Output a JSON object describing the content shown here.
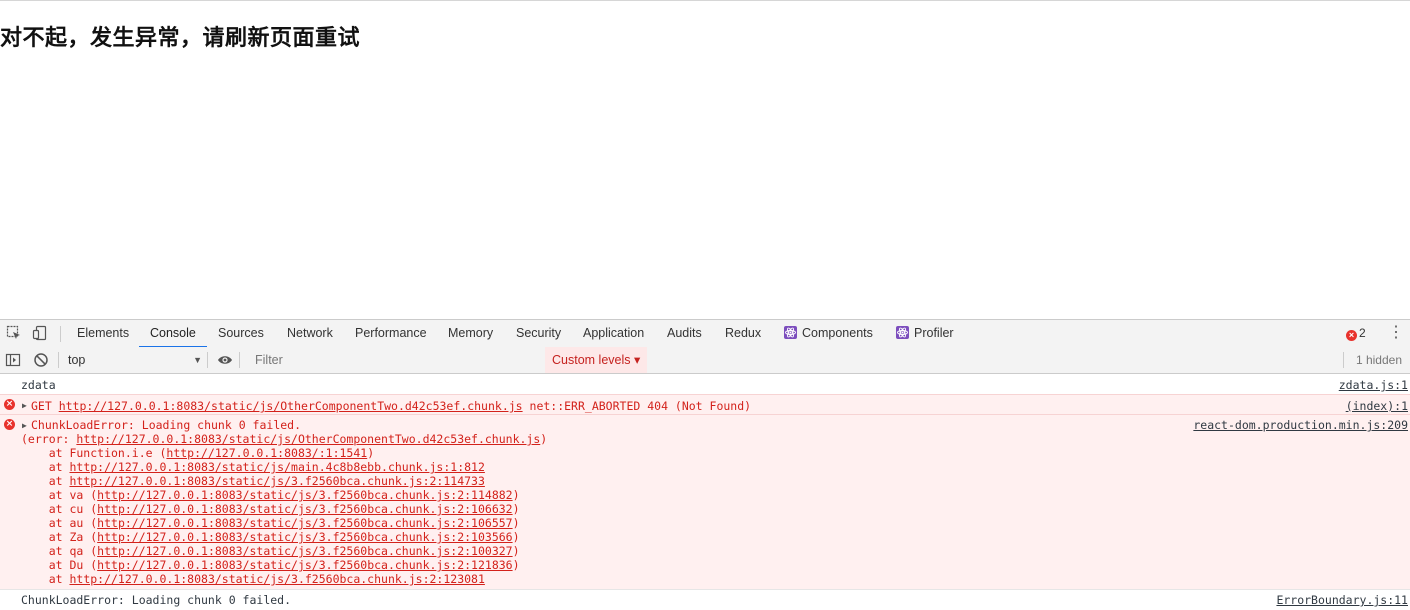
{
  "page": {
    "heading": "对不起，发生异常，请刷新页面重试"
  },
  "devtools": {
    "tabs": [
      "Elements",
      "Console",
      "Sources",
      "Network",
      "Performance",
      "Memory",
      "Security",
      "Application",
      "Audits",
      "Redux",
      "Components",
      "Profiler"
    ],
    "active_tab": "Console",
    "error_count": "2",
    "context": "top",
    "filter_placeholder": "Filter",
    "levels_label": "Custom levels ▾",
    "hidden_label": "1 hidden",
    "colors": {
      "accent": "#1a73e8",
      "error": "#d3221b",
      "error_bg": "#fff0f0"
    }
  },
  "console": {
    "log1": {
      "text": "zdata",
      "source": "zdata.js:1"
    },
    "error1": {
      "prefix": "GET ",
      "url": "http://127.0.0.1:8083/static/js/OtherComponentTwo.d42c53ef.chunk.js",
      "suffix": " net::ERR_ABORTED 404 (Not Found)",
      "source": "(index):1"
    },
    "error2": {
      "title": "ChunkLoadError: Loading chunk 0 failed.",
      "source": "react-dom.production.min.js:209",
      "error_prefix": "(error: ",
      "error_url": "http://127.0.0.1:8083/static/js/OtherComponentTwo.d42c53ef.chunk.js",
      "error_suffix": ")",
      "stack": [
        {
          "pre": "    at Function.i.e (",
          "url": "http://127.0.0.1:8083/:1:1541",
          "post": ")"
        },
        {
          "pre": "    at ",
          "url": "http://127.0.0.1:8083/static/js/main.4c8b8ebb.chunk.js:1:812",
          "post": ""
        },
        {
          "pre": "    at ",
          "url": "http://127.0.0.1:8083/static/js/3.f2560bca.chunk.js:2:114733",
          "post": ""
        },
        {
          "pre": "    at va (",
          "url": "http://127.0.0.1:8083/static/js/3.f2560bca.chunk.js:2:114882",
          "post": ")"
        },
        {
          "pre": "    at cu (",
          "url": "http://127.0.0.1:8083/static/js/3.f2560bca.chunk.js:2:106632",
          "post": ")"
        },
        {
          "pre": "    at au (",
          "url": "http://127.0.0.1:8083/static/js/3.f2560bca.chunk.js:2:106557",
          "post": ")"
        },
        {
          "pre": "    at Za (",
          "url": "http://127.0.0.1:8083/static/js/3.f2560bca.chunk.js:2:103566",
          "post": ")"
        },
        {
          "pre": "    at qa (",
          "url": "http://127.0.0.1:8083/static/js/3.f2560bca.chunk.js:2:100327",
          "post": ")"
        },
        {
          "pre": "    at Du (",
          "url": "http://127.0.0.1:8083/static/js/3.f2560bca.chunk.js:2:121836",
          "post": ")"
        },
        {
          "pre": "    at ",
          "url": "http://127.0.0.1:8083/static/js/3.f2560bca.chunk.js:2:123081",
          "post": ""
        }
      ]
    },
    "log2": {
      "text": "ChunkLoadError: Loading chunk 0 failed.",
      "source": "ErrorBoundary.js:11"
    }
  }
}
